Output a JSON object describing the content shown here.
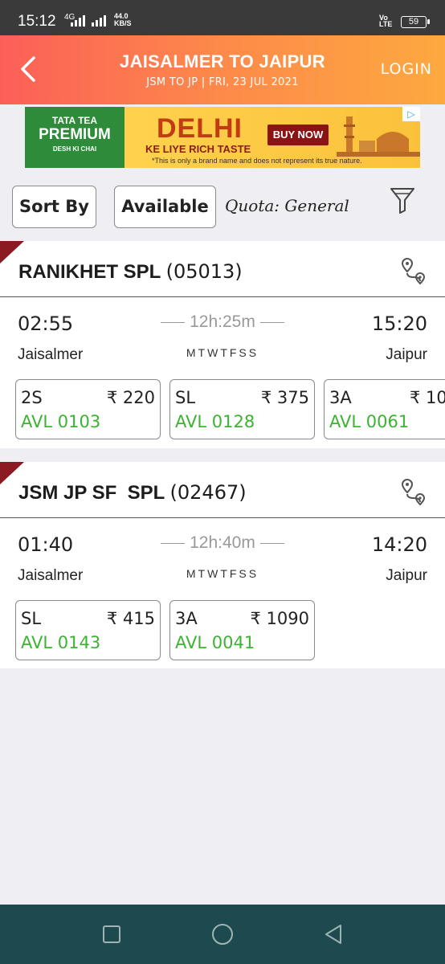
{
  "status_bar": {
    "time": "15:12",
    "network_type": "4G",
    "speed_value": "44.0",
    "speed_unit": "KB/S",
    "volte_line1": "Vo",
    "volte_line2": "LTE",
    "battery": "59"
  },
  "header": {
    "title": "JAISALMER TO JAIPUR",
    "subtitle": "JSM TO JP | FRI, 23 JUL  2021",
    "login_label": "LOGIN",
    "back_icon": "chevron-left-icon"
  },
  "ad": {
    "brand_line1": "TATA TEA",
    "brand_line2": "PREMIUM",
    "brand_line3": "DESH KI CHAI",
    "headline": "DELHI",
    "tagline": "KE LIYE RICH TASTE",
    "cta": "BUY NOW",
    "disclaimer": "*This is only a brand name and does not represent its true nature.",
    "colors": {
      "brand_bg": "#2e8b3a",
      "banner_bg": "#ffd04a",
      "headline": "#c23b12",
      "cta_bg": "#8c1313"
    }
  },
  "filters": {
    "sort_label": "Sort By",
    "available_label": "Available",
    "quota_label": "Quota:",
    "quota_value": "General",
    "filter_icon": "funnel-icon"
  },
  "trains": [
    {
      "name": "RANIKHET SPL",
      "number": "(05013)",
      "dep_time": "02:55",
      "arr_time": "15:20",
      "duration": "12h:25m",
      "dep_station": "Jaisalmer",
      "arr_station": "Jaipur",
      "days": "MTWTFSS",
      "classes": [
        {
          "name": "2S",
          "price": "₹ 220",
          "avl": "AVL  0103"
        },
        {
          "name": "SL",
          "price": "₹ 375",
          "avl": "AVL  0128"
        },
        {
          "name": "3A",
          "price": "₹ 10",
          "avl": "AVL  0061"
        }
      ]
    },
    {
      "name": "JSM JP SF  SPL",
      "number": "(02467)",
      "dep_time": "01:40",
      "arr_time": "14:20",
      "duration": "12h:40m",
      "dep_station": "Jaisalmer",
      "arr_station": "Jaipur",
      "days": "MTWTFSS",
      "classes": [
        {
          "name": "SL",
          "price": "₹ 415",
          "avl": "AVL  0143"
        },
        {
          "name": "3A",
          "price": "₹ 1090",
          "avl": "AVL  0041"
        }
      ]
    }
  ],
  "colors": {
    "header_gradient_start": "#fc5f58",
    "header_gradient_end": "#fda93f",
    "available_green": "#3bb431",
    "corner_accent": "#8b1a22",
    "navbar_bg": "#1d4a4e"
  }
}
